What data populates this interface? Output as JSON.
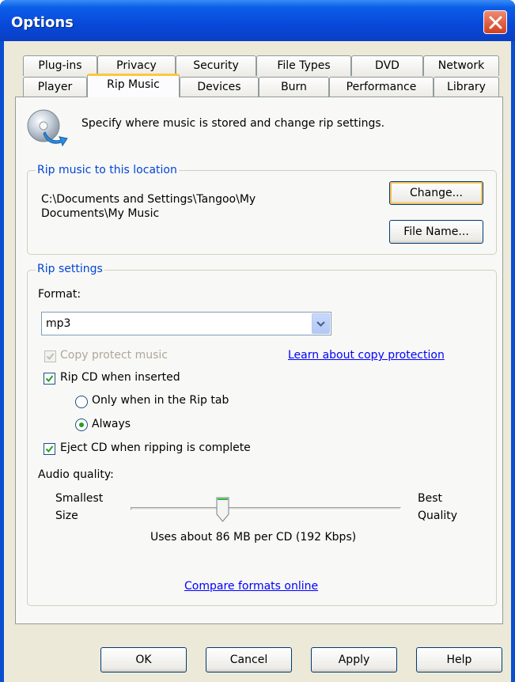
{
  "window": {
    "title": "Options"
  },
  "tabs_row1": [
    "Plug-ins",
    "Privacy",
    "Security",
    "File Types",
    "DVD",
    "Network"
  ],
  "tabs_row2": [
    "Player",
    "Rip Music",
    "Devices",
    "Burn",
    "Performance",
    "Library"
  ],
  "active_tab": "Rip Music",
  "description": "Specify where music is stored and change rip settings.",
  "location": {
    "group_label": "Rip music to this location",
    "path_line1": "C:\\Documents and Settings\\Tangoo\\My",
    "path_line2": "Documents\\My Music",
    "change_label": "Change...",
    "file_name_label": "File Name..."
  },
  "rip_settings": {
    "group_label": "Rip settings",
    "format_label": "Format:",
    "format_value": "mp3",
    "copy_protect_label": "Copy protect music",
    "copy_protect_checked": true,
    "copy_protect_enabled": false,
    "learn_link": "Learn about copy protection",
    "rip_when_inserted_label": "Rip CD when inserted",
    "rip_when_inserted_checked": true,
    "only_rip_tab_label": "Only when in the Rip tab",
    "always_label": "Always",
    "selected_radio": "Always",
    "eject_label": "Eject CD when ripping is complete",
    "eject_checked": true,
    "audio_quality_label": "Audio quality:",
    "smallest_label_1": "Smallest",
    "smallest_label_2": "Size",
    "best_label_1": "Best",
    "best_label_2": "Quality",
    "quality_fraction": 0.34,
    "usage_text": "Uses about 86 MB per CD (192 Kbps)",
    "compare_link": "Compare formats online"
  },
  "buttons": {
    "ok": "OK",
    "cancel": "Cancel",
    "apply": "Apply",
    "help": "Help"
  },
  "colors": {
    "title_bar": "#0a53e0",
    "group_label": "#0046d5",
    "link": "#0000ff",
    "dialog_bg": "#ece9d8"
  }
}
